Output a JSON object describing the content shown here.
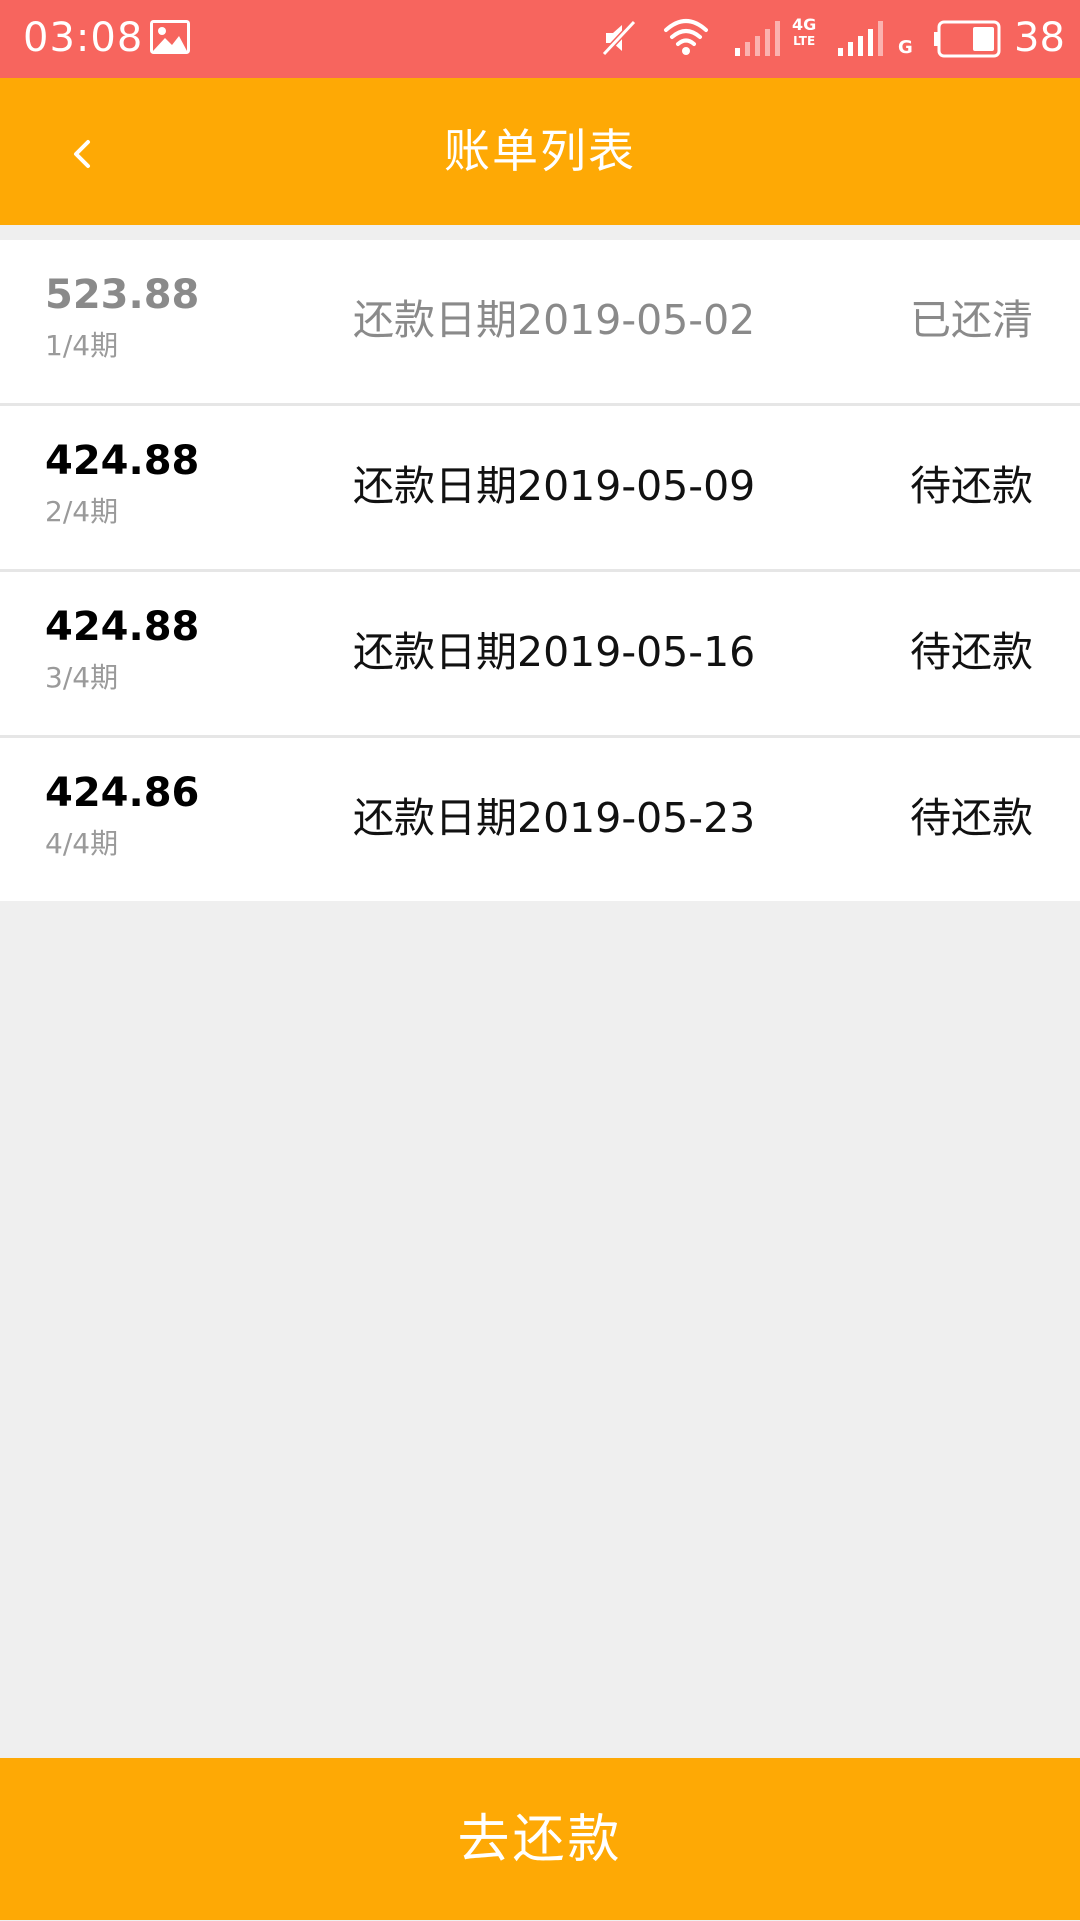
{
  "status_bar": {
    "time": "03:08",
    "network_label": "4G",
    "network_sub_label": "LTE",
    "second_network_label": "G",
    "battery_level": "38",
    "background_color": "#f7655e",
    "icons": [
      "gallery-icon",
      "mute-icon",
      "wifi-icon",
      "signal-icon",
      "signal-icon",
      "battery-icon"
    ]
  },
  "header": {
    "title": "账单列表",
    "back_icon": "chevron-left-icon",
    "background_color": "#fea905"
  },
  "bills": [
    {
      "amount": "523.88",
      "period": "1/4期",
      "date": "还款日期2019-05-02",
      "status": "已还清"
    },
    {
      "amount": "424.88",
      "period": "2/4期",
      "date": "还款日期2019-05-09",
      "status": "待还款"
    },
    {
      "amount": "424.88",
      "period": "3/4期",
      "date": "还款日期2019-05-16",
      "status": "待还款"
    },
    {
      "amount": "424.86",
      "period": "4/4期",
      "date": "还款日期2019-05-23",
      "status": "待还款"
    }
  ],
  "footer": {
    "repay_label": "去还款"
  }
}
